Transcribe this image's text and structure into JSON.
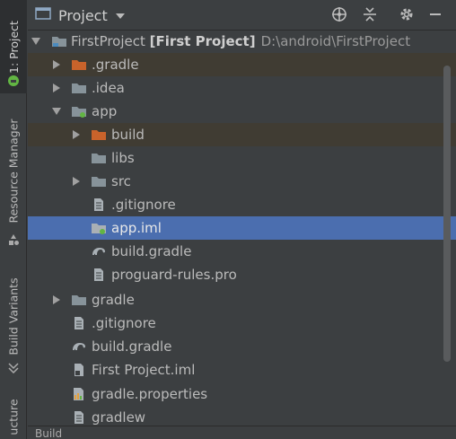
{
  "tool_strip": {
    "project_tab": "1: Project",
    "resource_manager_tab": "Resource Manager",
    "build_variants_tab": "Build Variants",
    "structure_tab": "ucture"
  },
  "header": {
    "title": "Project",
    "icons": [
      "globe-icon",
      "collapse-icon",
      "gear-icon",
      "minimize-icon"
    ]
  },
  "tree": {
    "root": {
      "name": "FirstProject",
      "module": "[First Project]",
      "path": "D:\\android\\FirstProject"
    },
    "items": [
      {
        "label": ".gradle"
      },
      {
        "label": ".idea"
      },
      {
        "label": "app"
      },
      {
        "label": "build"
      },
      {
        "label": "libs"
      },
      {
        "label": "src"
      },
      {
        "label": ".gitignore"
      },
      {
        "label": "app.iml"
      },
      {
        "label": "build.gradle"
      },
      {
        "label": "proguard-rules.pro"
      },
      {
        "label": "gradle"
      },
      {
        "label": ".gitignore"
      },
      {
        "label": "build.gradle"
      },
      {
        "label": "First Project.iml"
      },
      {
        "label": "gradle.properties"
      },
      {
        "label": "gradlew"
      }
    ]
  },
  "bottom_tabs": {
    "build": "Build"
  },
  "colors": {
    "panel_bg": "#3c3f41",
    "selection": "#4b6eaf",
    "excluded_row": "#403c33",
    "excluded_folder": "#c9632b",
    "folder": "#87939a",
    "module_dot": "#62b543"
  }
}
